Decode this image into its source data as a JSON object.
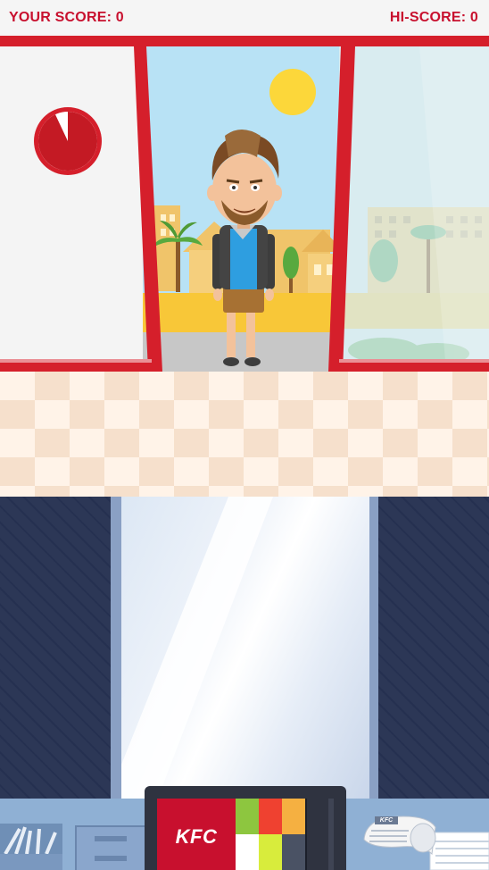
{
  "hud": {
    "score_label": "YOUR SCORE: 0",
    "hiscore_label": "HI-SCORE: 0"
  },
  "timer": {
    "remaining_fraction": 0.93
  },
  "register": {
    "brand_label": "KFC"
  },
  "receipt": {
    "brand_label": "KFC"
  },
  "colors": {
    "accent_red": "#d51f2b",
    "score_text": "#c8102e",
    "sky": "#b8e2f5",
    "sun": "#fcd73a",
    "counter_navy": "#2e3a5c"
  },
  "icons": {
    "timer": "timer-icon",
    "customer": "customer-character",
    "sun": "sun-icon"
  }
}
